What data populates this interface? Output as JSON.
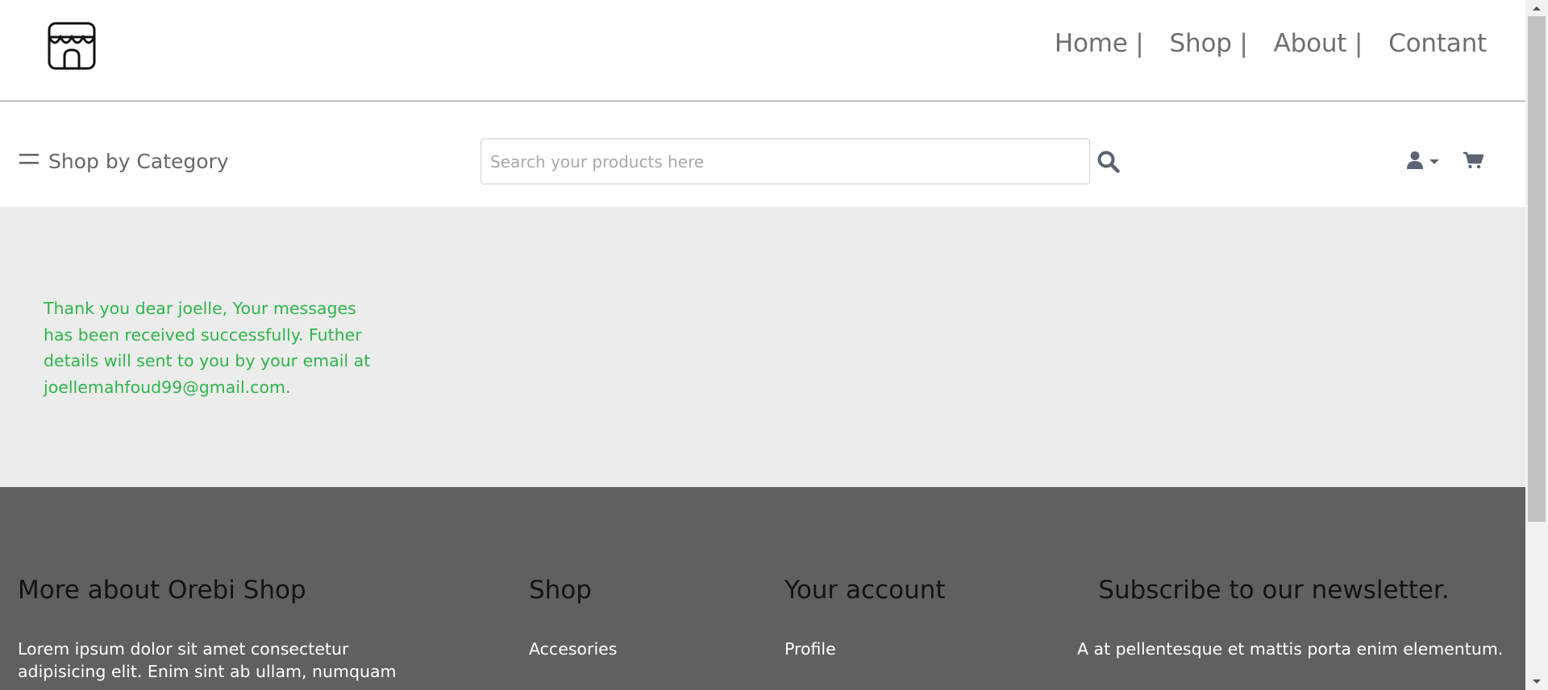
{
  "header": {
    "logo_icon": "storefront-icon",
    "nav": [
      {
        "label": "Home |"
      },
      {
        "label": "Shop |"
      },
      {
        "label": "About |"
      },
      {
        "label": "Contant"
      }
    ]
  },
  "subbar": {
    "category_label": "Shop by Category",
    "category_icon": "menu-icon",
    "search": {
      "placeholder": "Search your products here",
      "value": ""
    },
    "search_icon": "search-icon",
    "user_icon": "user-icon",
    "dropdown_icon": "caret-down-icon",
    "cart_icon": "cart-icon"
  },
  "message": {
    "text": "Thank you dear joelle, Your messages has been received successfully. Futher details will sent to you by your email at joellemahfoud99@gmail.com.",
    "color": "#2fb54a"
  },
  "footer": {
    "about": {
      "title": "More about Orebi Shop",
      "line1": "Lorem ipsum dolor sit amet consectetur",
      "line2": "adipisicing elit. Enim sint ab ullam, numquam"
    },
    "shop": {
      "title": "Shop",
      "items": [
        "Accesories"
      ]
    },
    "account": {
      "title": "Your account",
      "items": [
        "Profile"
      ]
    },
    "newsletter": {
      "title": "Subscribe to our newsletter.",
      "text": "A at pellentesque et mattis porta enim elementum."
    }
  },
  "colors": {
    "footer_bg": "#615f60",
    "message_bg": "#ececec",
    "accent_green": "#2fb54a"
  }
}
